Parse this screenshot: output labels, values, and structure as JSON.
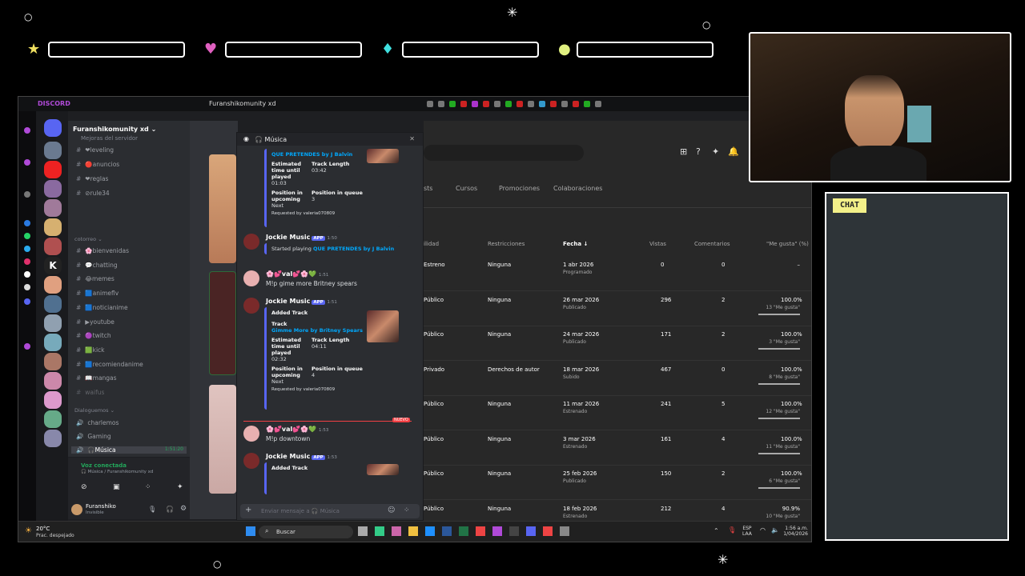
{
  "overlay": {
    "chat_title": "CHAT",
    "gems": [
      "★",
      "♥",
      "♦",
      "●"
    ],
    "gem_colors": [
      "#f0e060",
      "#e060c0",
      "#40e0e0",
      "#e0f080"
    ]
  },
  "discord": {
    "brand": "DISCORD",
    "window_title": "Furanshikomunity xd",
    "server_name": "Furanshikomunity xd",
    "server_subtitle": "Mejoras del servidor",
    "channels_top": [
      {
        "icon": "#",
        "label": "❤leveling"
      },
      {
        "icon": "#",
        "label": "🔴anuncios"
      },
      {
        "icon": "#",
        "label": "❤reglas"
      },
      {
        "icon": "#",
        "label": "⊘rule34"
      }
    ],
    "category_1": "cotorreo",
    "channels_mid": [
      {
        "icon": "#",
        "label": "🌸bienvenidas"
      },
      {
        "icon": "#",
        "label": "💬chatting"
      },
      {
        "icon": "#",
        "label": "😂memes"
      },
      {
        "icon": "#",
        "label": "🟦animeflv"
      },
      {
        "icon": "#",
        "label": "🟦noticianime"
      },
      {
        "icon": "#",
        "label": "▶youtube"
      },
      {
        "icon": "#",
        "label": "🟣twitch"
      },
      {
        "icon": "#",
        "label": "🟩kick"
      },
      {
        "icon": "#",
        "label": "🟦recomiendanime"
      },
      {
        "icon": "#",
        "label": "📖mangas"
      },
      {
        "icon": "#",
        "label": "waifus"
      }
    ],
    "category_2": "Dialoguemos",
    "voice_channels": [
      {
        "icon": "🔊",
        "label": "charlemos"
      },
      {
        "icon": "🔊",
        "label": "Gaming"
      },
      {
        "icon": "🔊",
        "label": "🎧Música",
        "time": "1:51:20"
      }
    ],
    "voice_status": "Voz conectada",
    "voice_path": "🎧 Música / Furanshikomunity xd",
    "user_name": "Furanshiko",
    "user_status": "Invisible",
    "popup_title": "🎧 Música",
    "messages": {
      "first_track": "QUE PRETENDES by J Balvin",
      "est_label": "Estimated time until played",
      "est_value_1": "01:03",
      "len_label": "Track Length",
      "len_value_1": "03:42",
      "pos_label": "Position in upcoming",
      "pos_value": "Next",
      "queue_label": "Position in queue",
      "queue_value_1": "3",
      "requested_by": "Requested by valeria070809",
      "bot_name": "Jockie Music",
      "app_tag": "APP",
      "bot_time_1": "1:50",
      "started_playing": "Started playing",
      "user_name": "🌸💕val💕🌸💚",
      "user_time_1": "1:51",
      "user_msg_1": "M!p gime more Britney spears",
      "bot_time_2": "1:51",
      "added_track": "Added Track",
      "track_label": "Track",
      "second_track": "Gimme More by Britney Spears",
      "est_value_2": "02:32",
      "len_value_2": "04:11",
      "queue_value_2": "4",
      "new_badge": "NUEVO",
      "user_time_2": "1:53",
      "user_msg_2": "M!p downtown",
      "bot_time_3": "1:53",
      "composer_placeholder": "Enviar mensaje a 🎧 Música"
    }
  },
  "youtube": {
    "tabs": [
      "sts",
      "Cursos",
      "Promociones",
      "Colaboraciones"
    ],
    "headers": [
      "ilidad",
      "Restricciones",
      "Fecha ↓",
      "Vistas",
      "Comentarios",
      "\"Me gusta\" (%)"
    ],
    "rows": [
      {
        "vis": "Estreno",
        "restr": "Ninguna",
        "date": "1 abr 2026",
        "sub": "Programado",
        "views": "0",
        "comments": "0",
        "likes": "–",
        "likes_sub": "",
        "bar": 0
      },
      {
        "vis": "Público",
        "restr": "Ninguna",
        "date": "26 mar 2026",
        "sub": "Publicado",
        "views": "296",
        "comments": "2",
        "likes": "100.0%",
        "likes_sub": "13 \"Me gusta\"",
        "bar": 1
      },
      {
        "vis": "Público",
        "restr": "Ninguna",
        "date": "24 mar 2026",
        "sub": "Publicado",
        "views": "171",
        "comments": "2",
        "likes": "100.0%",
        "likes_sub": "3 \"Me gusta\"",
        "bar": 1
      },
      {
        "vis": "Privado",
        "restr": "Derechos de autor",
        "date": "18 mar 2026",
        "sub": "Subido",
        "views": "467",
        "comments": "0",
        "likes": "100.0%",
        "likes_sub": "8 \"Me gusta\"",
        "bar": 1
      },
      {
        "vis": "Público",
        "restr": "Ninguna",
        "date": "11 mar 2026",
        "sub": "Estrenado",
        "views": "241",
        "comments": "5",
        "likes": "100.0%",
        "likes_sub": "12 \"Me gusta\"",
        "bar": 1
      },
      {
        "vis": "Público",
        "restr": "Ninguna",
        "date": "3 mar 2026",
        "sub": "Estrenado",
        "views": "161",
        "comments": "4",
        "likes": "100.0%",
        "likes_sub": "11 \"Me gusta\"",
        "bar": 1
      },
      {
        "vis": "Público",
        "restr": "Ninguna",
        "date": "25 feb 2026",
        "sub": "Publicado",
        "views": "150",
        "comments": "2",
        "likes": "100.0%",
        "likes_sub": "6 \"Me gusta\"",
        "bar": 1
      },
      {
        "vis": "Público",
        "restr": "Ninguna",
        "date": "18 feb 2026",
        "sub": "Estrenado",
        "views": "212",
        "comments": "4",
        "likes": "90.9%",
        "likes_sub": "10 \"Me gusta\"",
        "bar": 0.909
      }
    ]
  },
  "taskbar": {
    "weather_temp": "20°C",
    "weather_desc": "Prac. despejado",
    "search": "Buscar",
    "lang": "ESP",
    "lang2": "LAA",
    "time": "1:56 a.m.",
    "date": "1/04/2026"
  }
}
